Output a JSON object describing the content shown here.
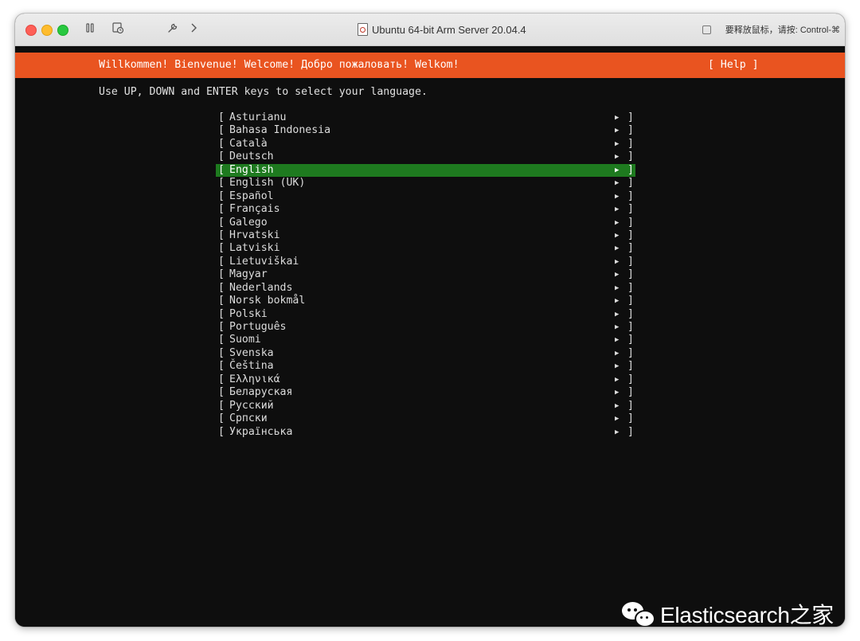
{
  "window": {
    "title": "Ubuntu 64-bit Arm Server 20.04.4",
    "release_hint": "要释放鼠标，请按: Control-⌘"
  },
  "toolbar": {
    "icons": [
      "pause-icon",
      "snapshot-icon",
      "settings-wrench-icon",
      "chevron-right-icon"
    ]
  },
  "installer": {
    "header": "Willkommen! Bienvenue! Welcome! Добро пожаловать! Welkom!",
    "help_label": "[ Help ]",
    "instructions": "Use UP, DOWN and ENTER keys to select your language.",
    "selected_index": 4,
    "languages": [
      {
        "label": "Asturianu"
      },
      {
        "label": "Bahasa Indonesia"
      },
      {
        "label": "Català"
      },
      {
        "label": "Deutsch"
      },
      {
        "label": "English"
      },
      {
        "label": "English (UK)"
      },
      {
        "label": "Español"
      },
      {
        "label": "Français"
      },
      {
        "label": "Galego"
      },
      {
        "label": "Hrvatski"
      },
      {
        "label": "Latviski"
      },
      {
        "label": "Lietuviškai"
      },
      {
        "label": "Magyar"
      },
      {
        "label": "Nederlands"
      },
      {
        "label": "Norsk bokmål"
      },
      {
        "label": "Polski"
      },
      {
        "label": "Português"
      },
      {
        "label": "Suomi"
      },
      {
        "label": "Svenska"
      },
      {
        "label": "Čeština"
      },
      {
        "label": "Ελληνικά"
      },
      {
        "label": "Беларуская"
      },
      {
        "label": "Русский"
      },
      {
        "label": "Српски"
      },
      {
        "label": "Українська"
      }
    ],
    "bracket_open": "[",
    "bracket_close": "]",
    "arrow": "▶"
  },
  "watermark": {
    "text": "Elasticsearch之家"
  },
  "colors": {
    "header_orange": "#e95420",
    "selection_green": "#1e7a1f",
    "terminal_bg": "#0e0e0e"
  }
}
